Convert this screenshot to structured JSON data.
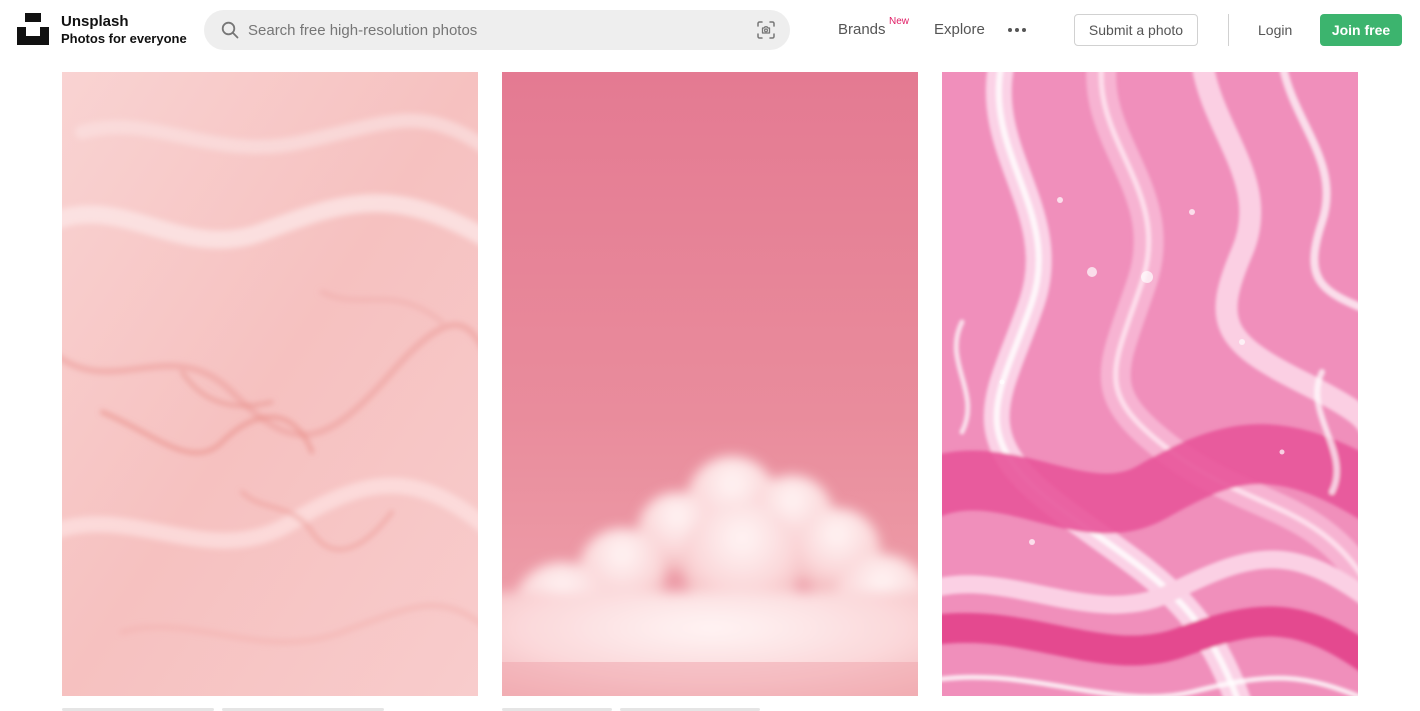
{
  "header": {
    "brand_name": "Unsplash",
    "brand_tagline": "Photos for everyone",
    "logo_icon": "unsplash-logo-icon",
    "search": {
      "placeholder": "Search free high-resolution photos",
      "value": "",
      "search_icon": "search-icon",
      "visual_search_icon": "visual-search-icon"
    },
    "nav": {
      "brands_label": "Brands",
      "brands_badge": "New",
      "explore_label": "Explore",
      "more_icon": "more-horizontal-icon"
    },
    "submit_label": "Submit a photo",
    "login_label": "Login",
    "join_label": "Join free"
  },
  "colors": {
    "accent_green": "#3cb46e",
    "badge_pink": "#e01c64",
    "search_bg": "#eeeeee"
  },
  "gallery": {
    "photos": [
      {
        "subject": "pink-marble-texture",
        "dominant_color": "#f7c6c4"
      },
      {
        "subject": "pink-sky-cloud",
        "dominant_color": "#e8849a"
      },
      {
        "subject": "pink-fluid-art",
        "dominant_color": "#ef7fae"
      }
    ]
  }
}
